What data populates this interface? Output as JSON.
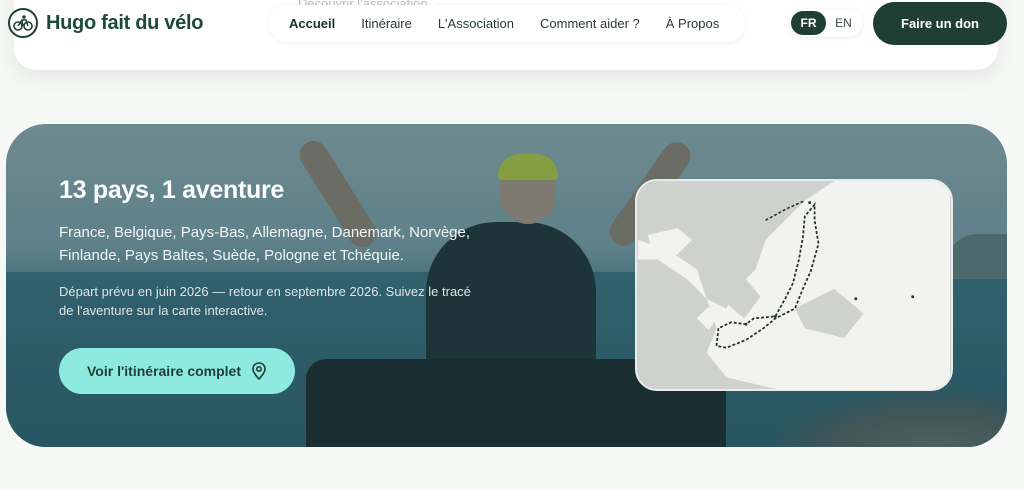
{
  "brand": {
    "name": "Hugo fait du vélo"
  },
  "top_card": {
    "ghost_link": "Découvrir l'association →"
  },
  "nav": {
    "items": [
      {
        "label": "Accueil",
        "active": true
      },
      {
        "label": "Itinéraire"
      },
      {
        "label": "L'Association"
      },
      {
        "label": "Comment aider ?"
      },
      {
        "label": "À Propos"
      }
    ]
  },
  "lang": {
    "fr": "FR",
    "en": "EN",
    "selected": "FR"
  },
  "donate": {
    "label": "Faire un don"
  },
  "hero": {
    "title": "13 pays, 1 aventure",
    "countries": "France, Belgique, Pays-Bas, Allemagne, Danemark, Norvège, Finlande, Pays Baltes, Suède, Pologne et Tchéquie.",
    "description": "Départ prévu en juin 2026 — retour en septembre 2026. Suivez le tracé de l'aventure sur la carte interactive.",
    "cta_label": "Voir l'itinéraire complet"
  },
  "icons": [
    "bicycle-logo-icon",
    "map-pin-icon"
  ],
  "colors": {
    "primary": "#1f3f35",
    "accent": "#8eeadf",
    "background": "#f6f8f6"
  }
}
